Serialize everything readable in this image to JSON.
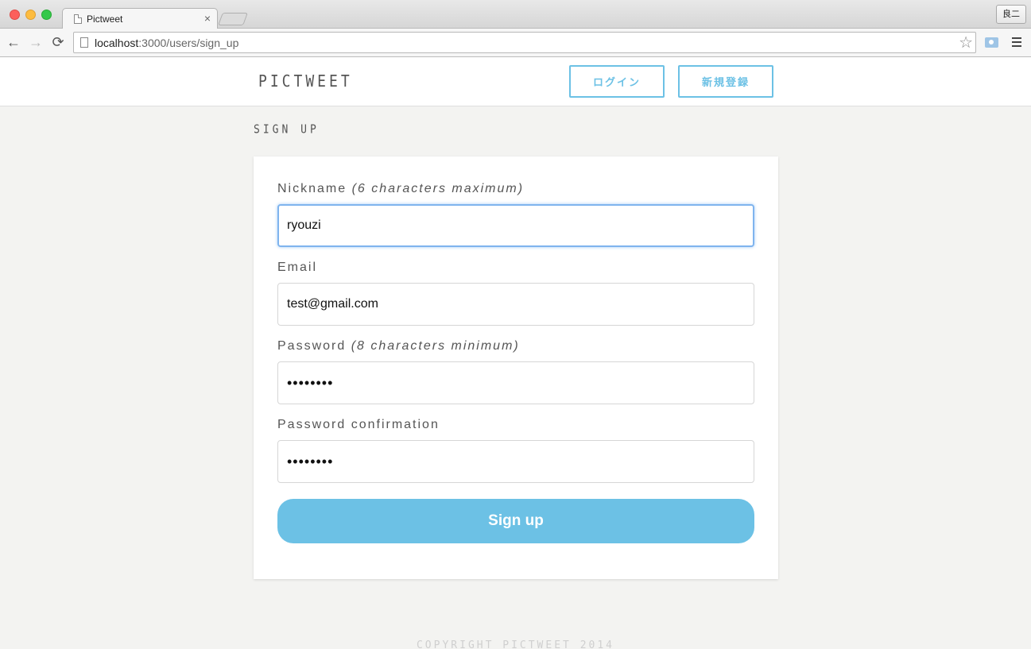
{
  "browser": {
    "tab_title": "Pictweet",
    "tab_close": "×",
    "profile_label": "良二",
    "url_host": "localhost",
    "url_path": ":3000/users/sign_up",
    "back": "←",
    "forward": "→",
    "reload": "⟳",
    "star": "☆"
  },
  "header": {
    "logo": "PICTWEET",
    "login_label": "ログイン",
    "signup_label": "新規登録"
  },
  "page": {
    "heading": "SIGN UP"
  },
  "form": {
    "nickname_label": "Nickname ",
    "nickname_hint": "(6 characters maximum)",
    "nickname_value": "ryouzi",
    "email_label": "Email",
    "email_value": "test@gmail.com",
    "password_label": "Password ",
    "password_hint": "(8 characters minimum)",
    "password_value": "••••••••",
    "password_confirmation_label": "Password confirmation",
    "password_confirmation_value": "••••••••",
    "submit_label": "Sign up"
  },
  "footer": {
    "text": "COPYRIGHT PICTWEET 2014"
  },
  "colors": {
    "accent": "#6cc1e5",
    "background": "#f3f3f1",
    "focus_ring": "#7fb4ee"
  }
}
